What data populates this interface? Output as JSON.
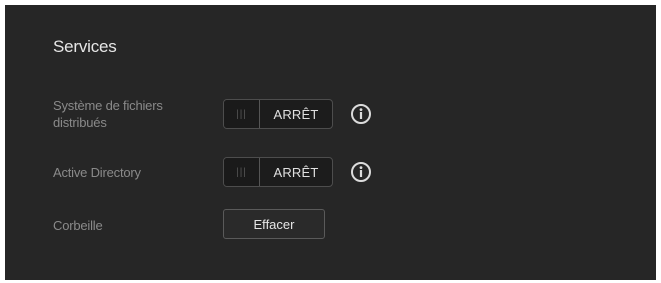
{
  "section": {
    "title": "Services"
  },
  "rows": [
    {
      "label": "Système de fichiers distribués",
      "toggle": {
        "grip": "|||",
        "state": "ARRÊT"
      },
      "info_icon": "info-circle-icon"
    },
    {
      "label": "Active Directory",
      "toggle": {
        "grip": "|||",
        "state": "ARRÊT"
      },
      "info_icon": "info-circle-icon"
    },
    {
      "label": "Corbeille",
      "button": "Effacer"
    }
  ],
  "colors": {
    "panel_background": "#262626",
    "title_text": "#e6e6e6",
    "label_text": "#8a8a8a",
    "toggle_background": "#1c1c1c",
    "toggle_border": "#4d4d4d"
  }
}
